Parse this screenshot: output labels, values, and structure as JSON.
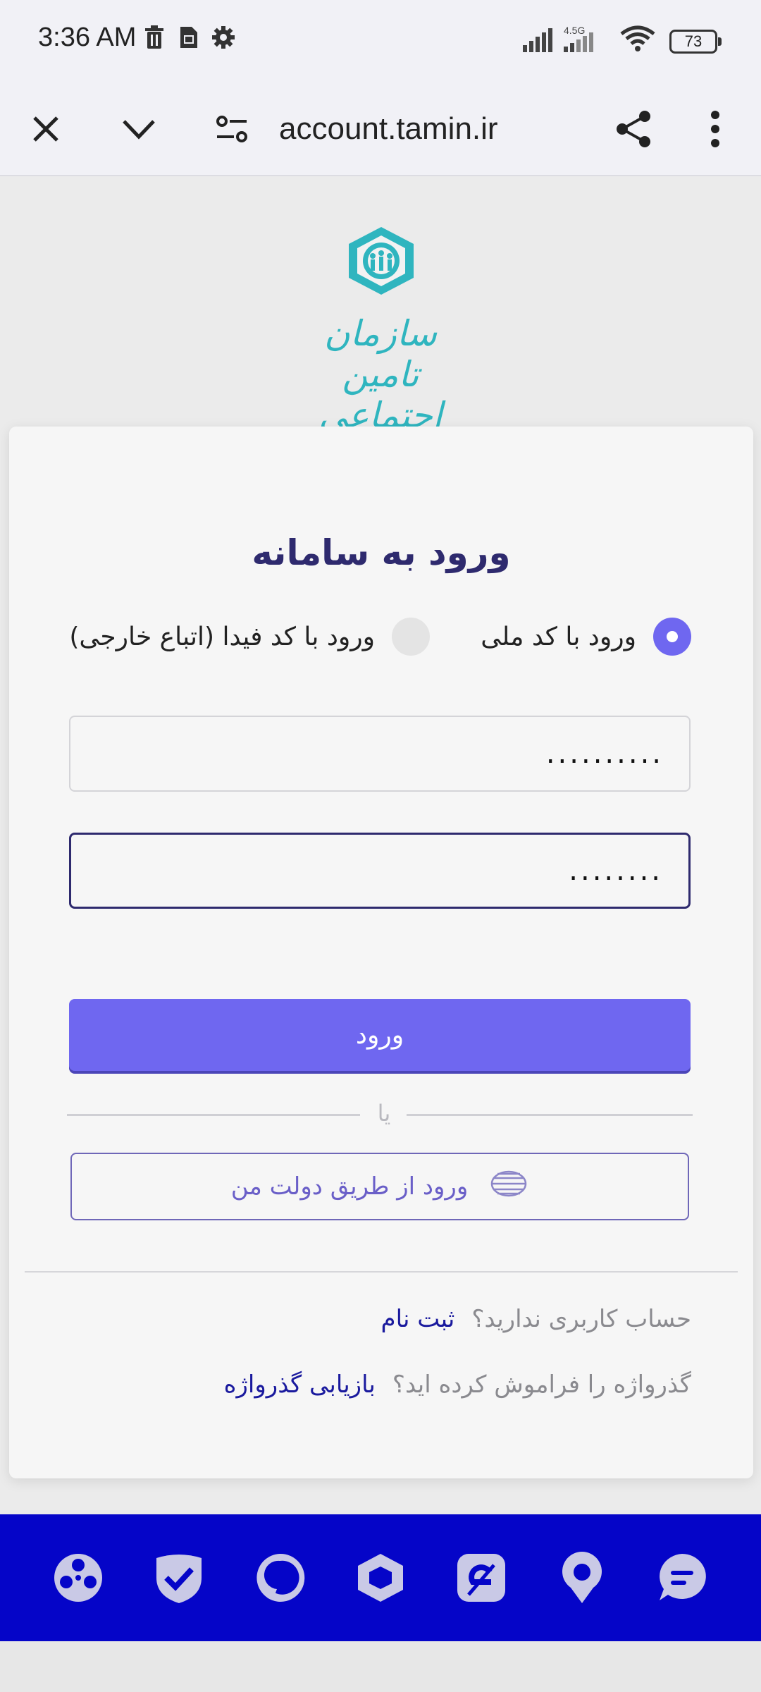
{
  "status_bar": {
    "time": "3:36 AM",
    "network": "4.5G",
    "battery": "73"
  },
  "browser": {
    "url": "account.tamin.ir"
  },
  "logo": {
    "text": "سازمان تامین اجتماعی",
    "color": "#2fb5bf"
  },
  "login": {
    "title": "ورود به سامانه",
    "options": [
      {
        "label": "ورود با کد ملی",
        "selected": true
      },
      {
        "label": "ورود با کد فیدا (اتباع خارجی)",
        "selected": false
      }
    ],
    "username_value": "..........",
    "password_value": "........",
    "submit_label": "ورود",
    "or_label": "یا",
    "gov_login_label": "ورود از طریق دولت من",
    "no_account_text": "حساب کاربری ندارید؟",
    "register_link": "ثبت نام",
    "forgot_text": "گذرواژه را فراموش کرده اید؟",
    "recover_link": "بازیابی گذرواژه"
  },
  "colors": {
    "accent": "#6f67f0",
    "title": "#2e2a6e",
    "appbar": "#0505c8",
    "link": "#1a1a9e"
  },
  "app_bar": {
    "icons": [
      "film-reel-icon",
      "shield-check-icon",
      "s-brand-icon",
      "hexagon-icon",
      "e-brand-icon",
      "location-pin-icon",
      "chat-bubble-icon"
    ]
  }
}
